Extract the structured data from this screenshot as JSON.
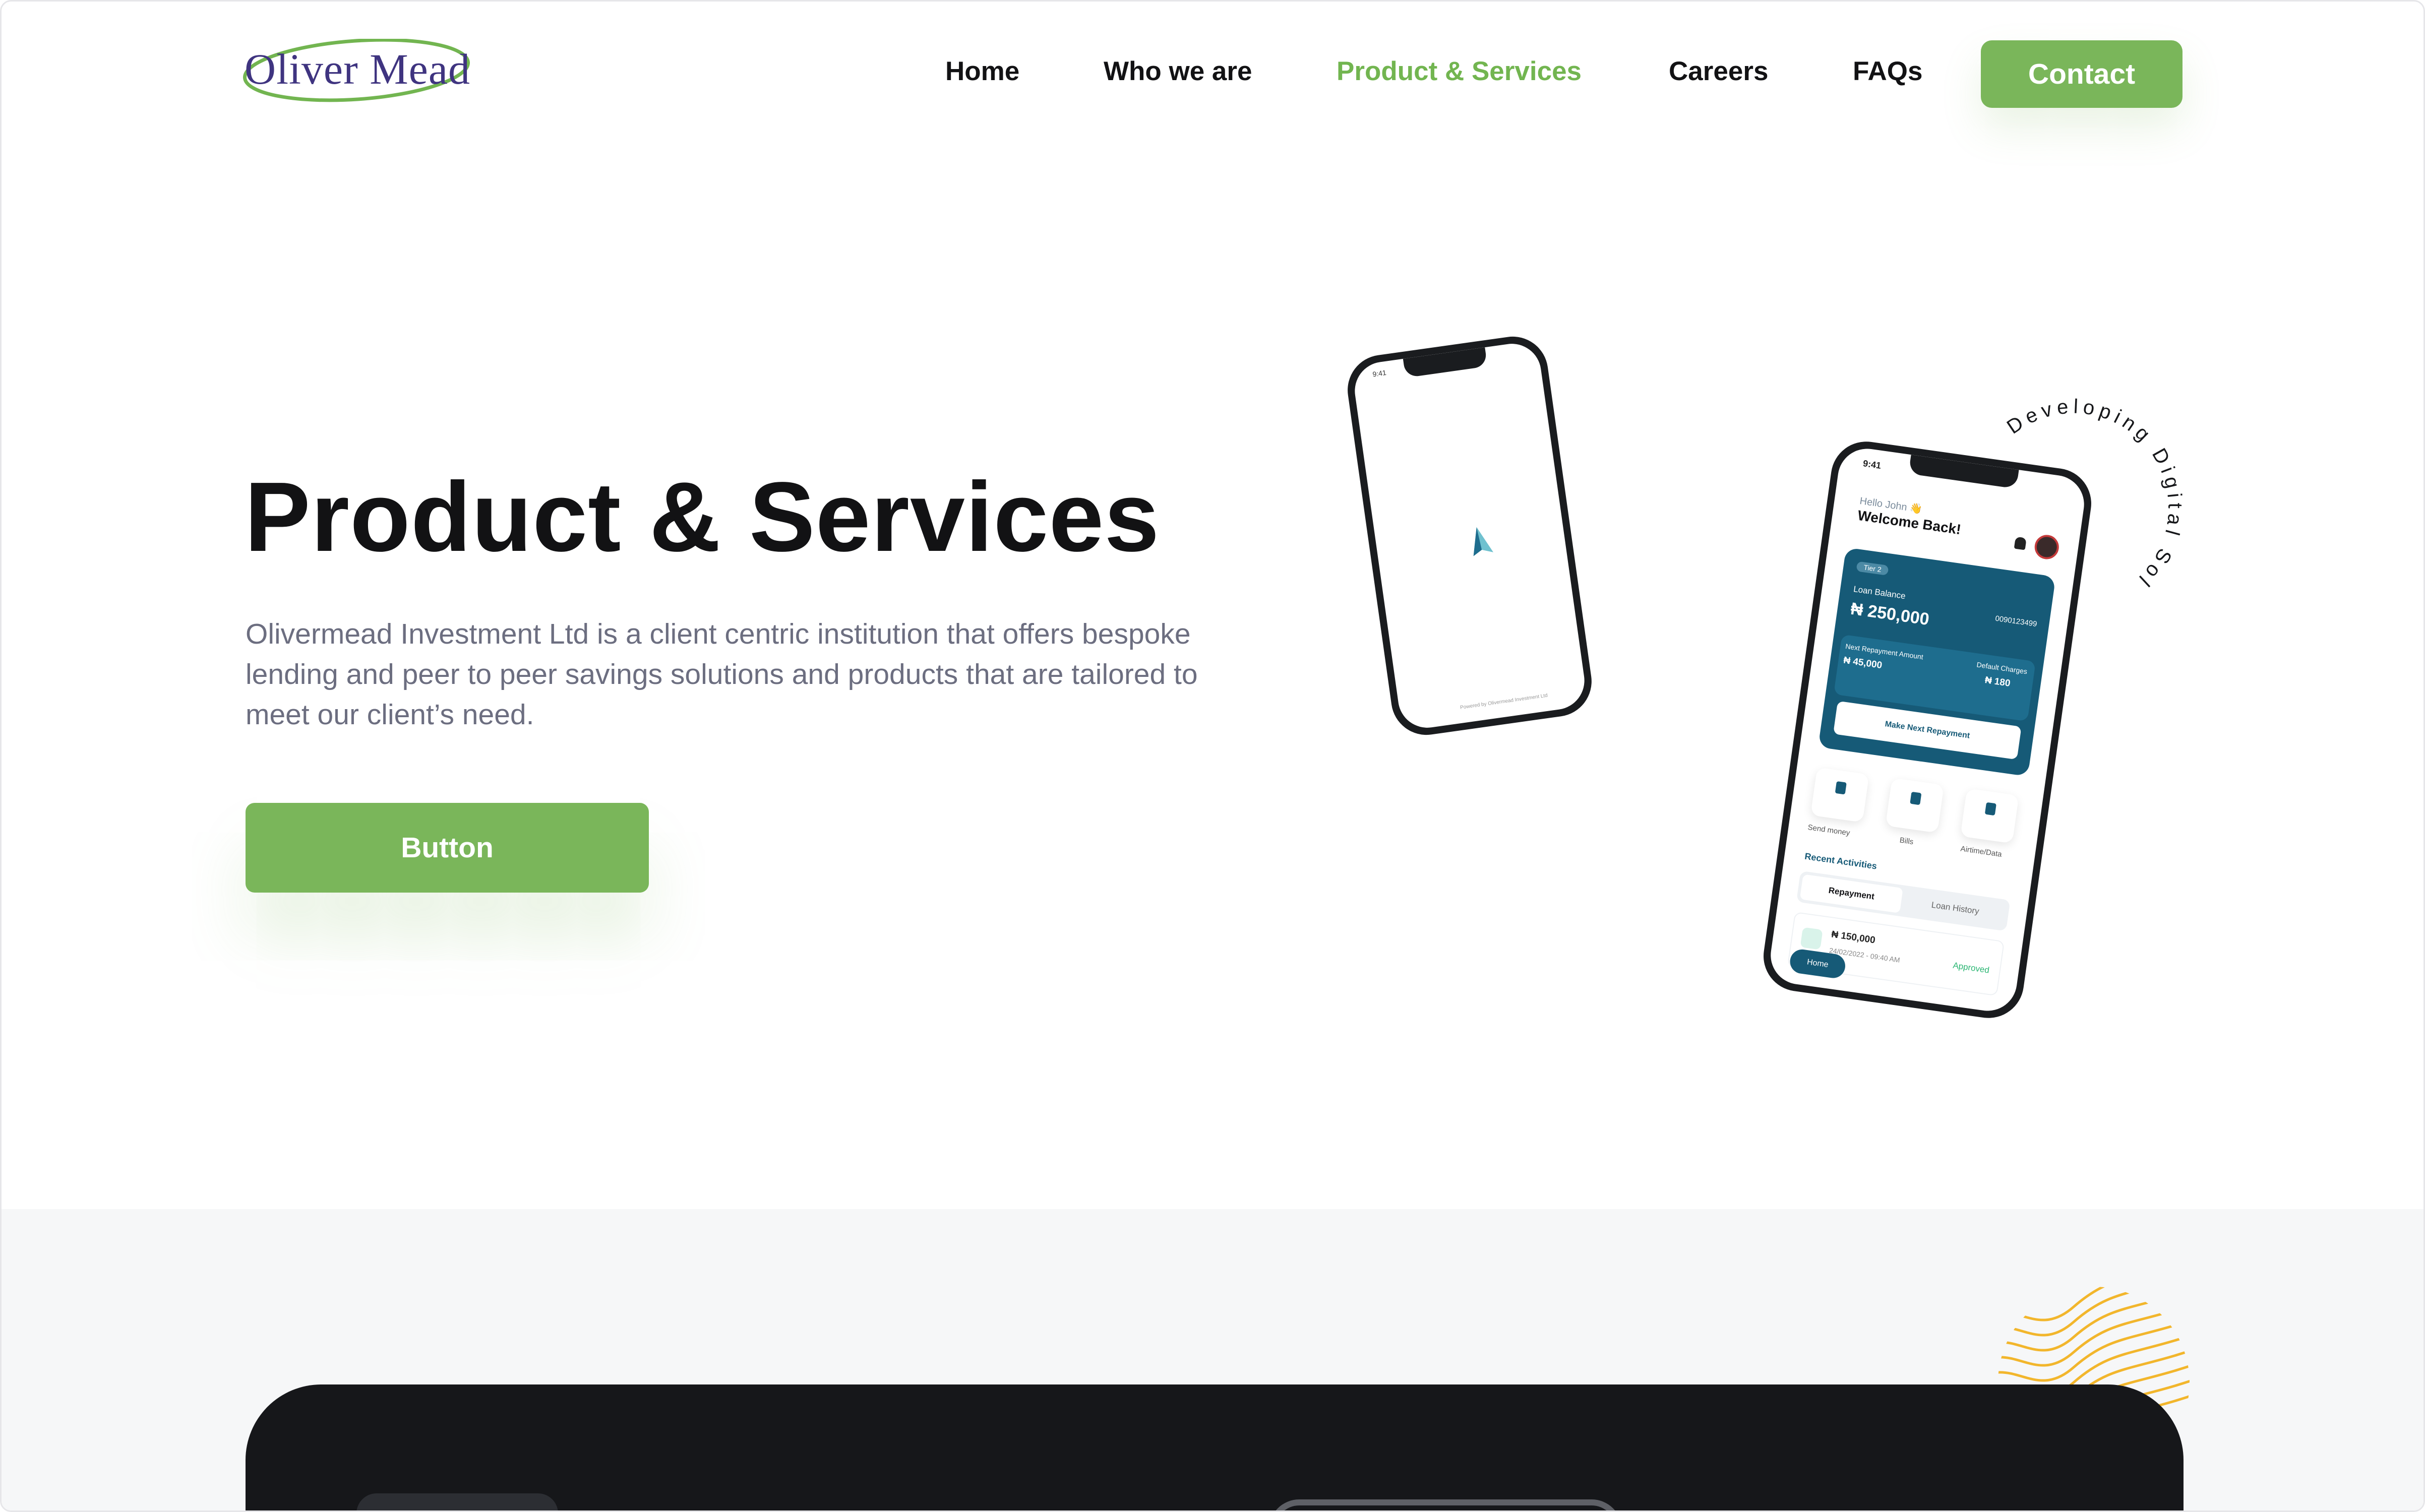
{
  "brand": {
    "name": "Oliver Mead",
    "text_color": "#3f3480",
    "swoosh_color": "#72b550"
  },
  "nav": {
    "items": [
      {
        "label": "Home",
        "active": false
      },
      {
        "label": "Who we are",
        "active": false
      },
      {
        "label": "Product & Services",
        "active": true
      },
      {
        "label": "Careers",
        "active": false
      },
      {
        "label": "FAQs",
        "active": false
      }
    ],
    "contact_label": "Contact"
  },
  "hero": {
    "title": "Product & Services",
    "description": "Olivermead Investment Ltd is a client centric institution that offers bespoke lending and peer to peer savings  solutions and products that are tailored to meet our client’s need.",
    "button_label": "Button",
    "circle_text": "Developing Digital Solutions"
  },
  "phone_splash": {
    "time": "9:41",
    "footer": "Powered by Olivermead Investment Ltd"
  },
  "phone_app": {
    "time": "9:41",
    "greeting": "Hello John 👋",
    "welcome": "Welcome Back!",
    "tier": "Tier 2",
    "loan_balance_label": "Loan Balance",
    "loan_balance": "₦ 250,000",
    "account_number": "0090123499",
    "next_repayment_label": "Next Repayment Amount",
    "next_repayment": "₦ 45,000",
    "default_charges_label": "Default Charges",
    "default_charges": "₦ 180",
    "make_repayment": "Make Next Repayment",
    "actions": [
      "Send money",
      "Bills",
      "Airtime/Data"
    ],
    "recent_label": "Recent Activities",
    "tabs": [
      "Repayment",
      "Loan History"
    ],
    "activity": {
      "amount": "₦ 150,000",
      "date": "24/02/2022 - 09:40 AM",
      "status": "Approved"
    },
    "home_label": "Home"
  },
  "colors": {
    "accent": "#7ab65a",
    "nav_active": "#72b550",
    "text_dark": "#121214",
    "text_muted": "#6c6e80",
    "app_primary": "#165a77",
    "wave": "#f2b62c",
    "dark_panel": "#16171a",
    "lower_bg": "#f6f7f8"
  }
}
